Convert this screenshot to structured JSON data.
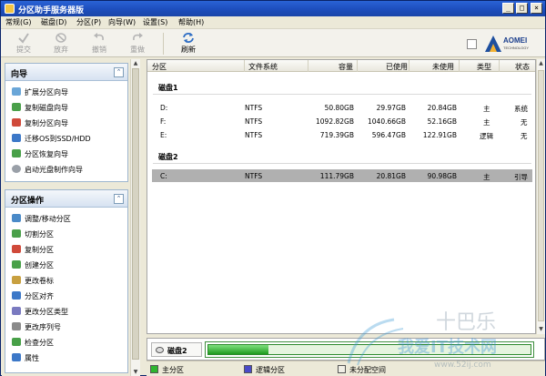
{
  "window": {
    "title": "分区助手服务器版"
  },
  "menu": [
    "常规(G)",
    "磁盘(D)",
    "分区(P)",
    "向导(W)",
    "设置(S)",
    "帮助(H)"
  ],
  "window_buttons": {
    "minimize": "_",
    "maximize": "□",
    "close": "×"
  },
  "toolbar": {
    "buttons": [
      {
        "label": "提交",
        "icon": "commit-icon",
        "enabled": false
      },
      {
        "label": "放弃",
        "icon": "discard-icon",
        "enabled": false
      },
      {
        "label": "撤销",
        "icon": "undo-icon",
        "enabled": false
      },
      {
        "label": "重做",
        "icon": "redo-icon",
        "enabled": false
      },
      {
        "label": "刷新",
        "icon": "refresh-icon",
        "enabled": true
      }
    ],
    "logo": {
      "brand": "AOMEI",
      "sub": "TECHNOLOGY"
    }
  },
  "wizard_panel": {
    "title": "向导",
    "items": [
      "扩展分区向导",
      "复制磁盘向导",
      "复制分区向导",
      "迁移OS到SSD/HDD",
      "分区恢复向导",
      "启动光盘制作向导"
    ]
  },
  "ops_panel": {
    "title": "分区操作",
    "items": [
      "调整/移动分区",
      "切割分区",
      "复制分区",
      "创建分区",
      "更改卷标",
      "分区对齐",
      "更改分区类型",
      "更改序列号",
      "检查分区",
      "属性"
    ]
  },
  "table": {
    "columns": [
      "分区",
      "文件系统",
      "容量",
      "已使用",
      "未使用",
      "类型",
      "状态"
    ],
    "disks": [
      {
        "name": "磁盘1",
        "rows": [
          {
            "partition": "D:",
            "fs": "NTFS",
            "capacity": "50.80GB",
            "used": "29.97GB",
            "free": "20.84GB",
            "type": "主",
            "status": "系统"
          },
          {
            "partition": "F:",
            "fs": "NTFS",
            "capacity": "1092.82GB",
            "used": "1040.66GB",
            "free": "52.16GB",
            "type": "主",
            "status": "无"
          },
          {
            "partition": "E:",
            "fs": "NTFS",
            "capacity": "719.39GB",
            "used": "596.47GB",
            "free": "122.91GB",
            "type": "逻辑",
            "status": "无"
          }
        ]
      },
      {
        "name": "磁盘2",
        "rows": [
          {
            "partition": "C:",
            "fs": "NTFS",
            "capacity": "111.79GB",
            "used": "20.81GB",
            "free": "90.98GB",
            "type": "主",
            "status": "引导"
          }
        ]
      }
    ]
  },
  "disk_map": {
    "label": "磁盘2",
    "used_fraction": 0.186
  },
  "legend": [
    {
      "label": "主分区",
      "color": "#2fb52f"
    },
    {
      "label": "逻辑分区",
      "color": "#4a4ac8"
    },
    {
      "label": "未分配空间",
      "color": "#f1efe6"
    }
  ],
  "watermark": {
    "big": "十巴乐",
    "text": "我爱IT技术网",
    "url": "www.52ij.com"
  },
  "colors": {
    "title_bar": "#1e4fbf",
    "selection": "#b0b0b0",
    "panel_border": "#9eb6ce"
  }
}
